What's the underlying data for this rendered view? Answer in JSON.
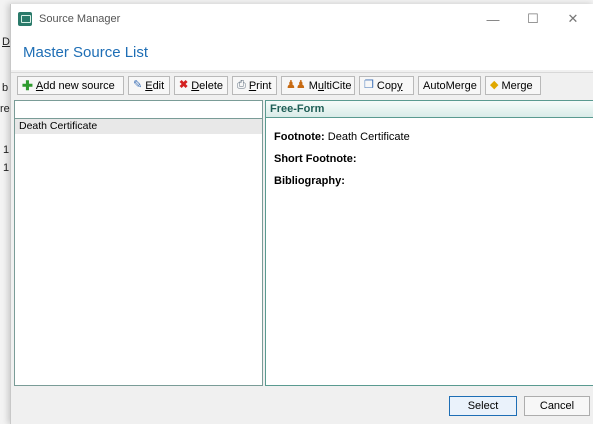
{
  "window": {
    "title": "Source Manager",
    "controls": {
      "minimize": "—",
      "maximize": "☐",
      "close": "✕"
    }
  },
  "header": {
    "title": "Master Source List"
  },
  "background_fragments": [
    "D",
    "b",
    "re",
    "1",
    "1"
  ],
  "toolbar": {
    "add_new_source": {
      "pre": "",
      "mnemonic": "A",
      "post": "dd new source"
    },
    "edit": {
      "pre": "",
      "mnemonic": "E",
      "post": "dit"
    },
    "delete": {
      "pre": "",
      "mnemonic": "D",
      "post": "elete"
    },
    "print": {
      "pre": "",
      "mnemonic": "P",
      "post": "rint"
    },
    "multicite": {
      "pre": "M",
      "mnemonic": "u",
      "post": "ltiCite"
    },
    "copy": {
      "pre": "Cop",
      "mnemonic": "y",
      "post": ""
    },
    "automerge": {
      "label": "AutoMerge"
    },
    "merge": {
      "label": "Merge"
    }
  },
  "source_list": {
    "header": "",
    "items": [
      "Death Certificate"
    ]
  },
  "details": {
    "header": "Free-Form",
    "footnote_label": "Footnote:",
    "footnote_value": "Death Certificate",
    "short_footnote_label": "Short Footnote:",
    "short_footnote_value": "",
    "bibliography_label": "Bibliography:",
    "bibliography_value": ""
  },
  "footer": {
    "select_label": "Select",
    "cancel_label": "Cancel"
  },
  "colors": {
    "accent": "#1e6eb5",
    "panel_border": "#5a9a90",
    "header_text": "#1f5e56"
  }
}
